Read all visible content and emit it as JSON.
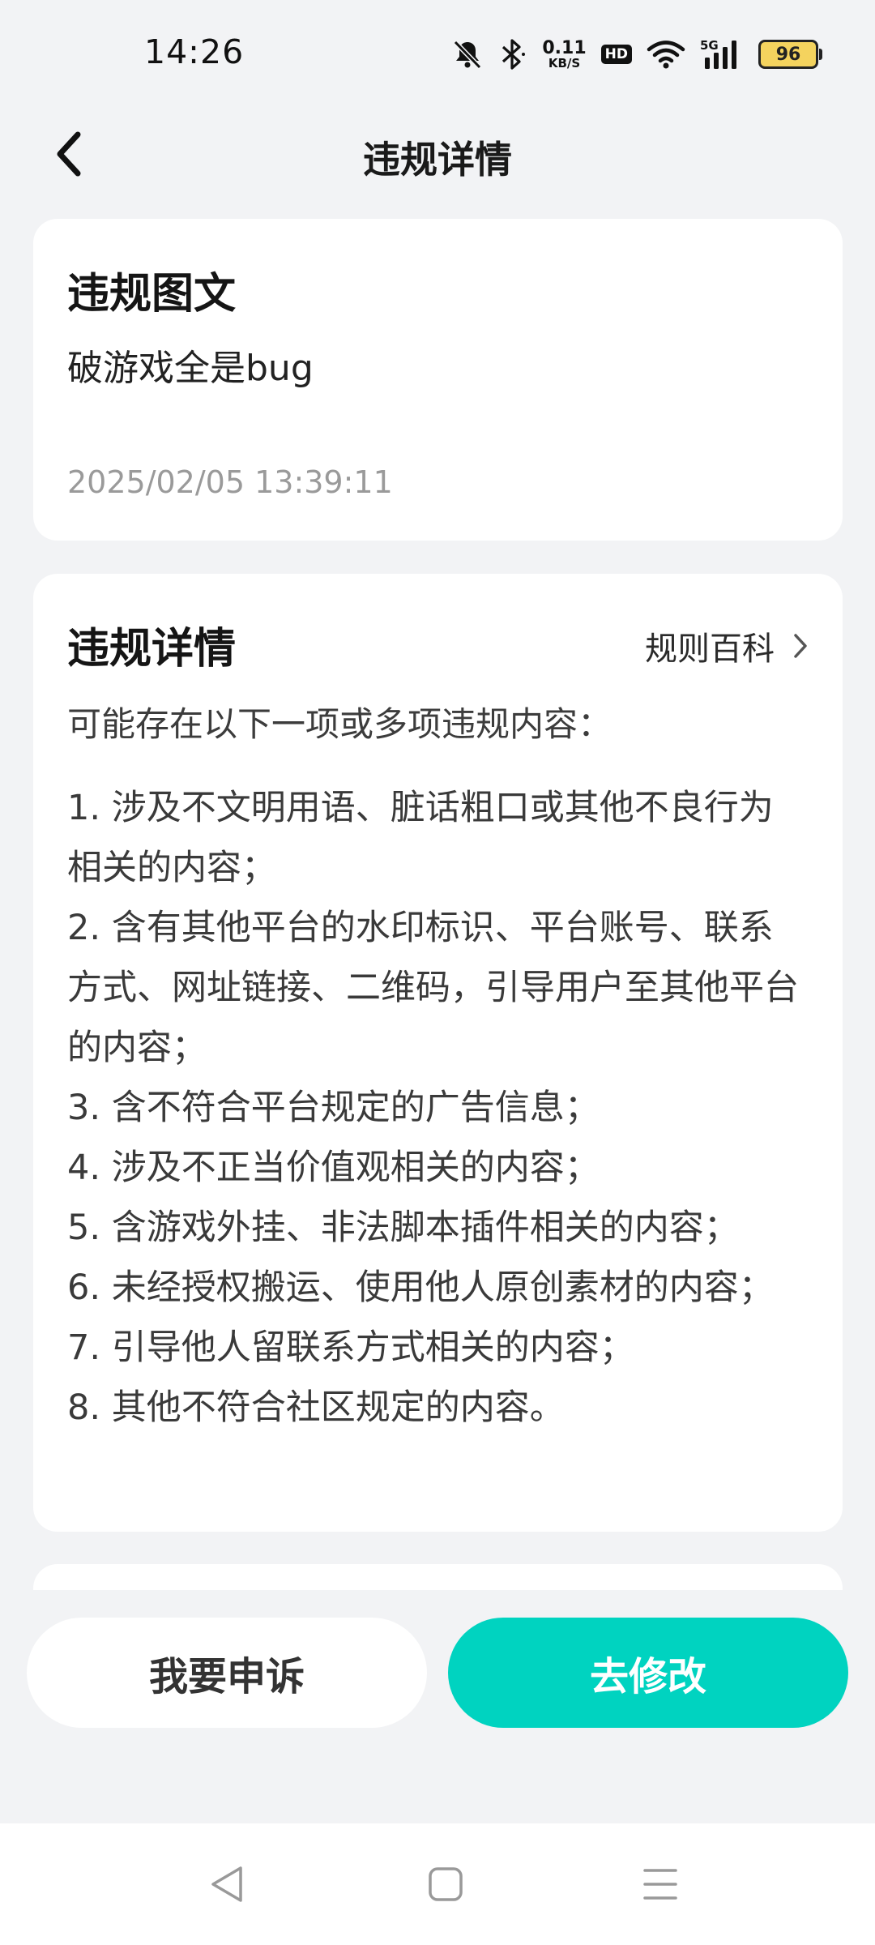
{
  "status_bar": {
    "time": "14:26",
    "net_speed_value": "0.11",
    "net_speed_unit": "KB/S",
    "hd_label": "HD",
    "signal_label": "5G",
    "battery_level": "96"
  },
  "nav": {
    "title": "违规详情"
  },
  "post_card": {
    "heading": "违规图文",
    "content": "破游戏全是bug",
    "timestamp": "2025/02/05 13:39:11"
  },
  "detail_card": {
    "heading": "违规详情",
    "rules_link_label": "规则百科",
    "intro": "可能存在以下一项或多项违规内容：",
    "items": [
      "1. 涉及不文明用语、脏话粗口或其他不良行为相关的内容；",
      "2. 含有其他平台的水印标识、平台账号、联系方式、网址链接、二维码，引导用户至其他平台的内容；",
      "3. 含不符合平台规定的广告信息；",
      "4. 涉及不正当价值观相关的内容；",
      "5. 含游戏外挂、非法脚本插件相关的内容；",
      "6. 未经授权搬运、使用他人原创素材的内容；",
      "7. 引导他人留联系方式相关的内容；",
      "8. 其他不符合社区规定的内容。"
    ]
  },
  "actions": {
    "appeal_label": "我要申诉",
    "modify_label": "去修改"
  },
  "colors": {
    "accent": "#00d3c0",
    "background": "#f2f3f5",
    "card": "#ffffff",
    "muted_text": "#9a9a9a",
    "battery_fill": "#f4d35e"
  },
  "icons": {
    "back": "chevron-left-icon",
    "rules_link": "chevron-right-icon",
    "sys_back": "triangle-back-icon",
    "sys_home": "square-home-icon",
    "sys_menu": "hamburger-menu-icon"
  }
}
